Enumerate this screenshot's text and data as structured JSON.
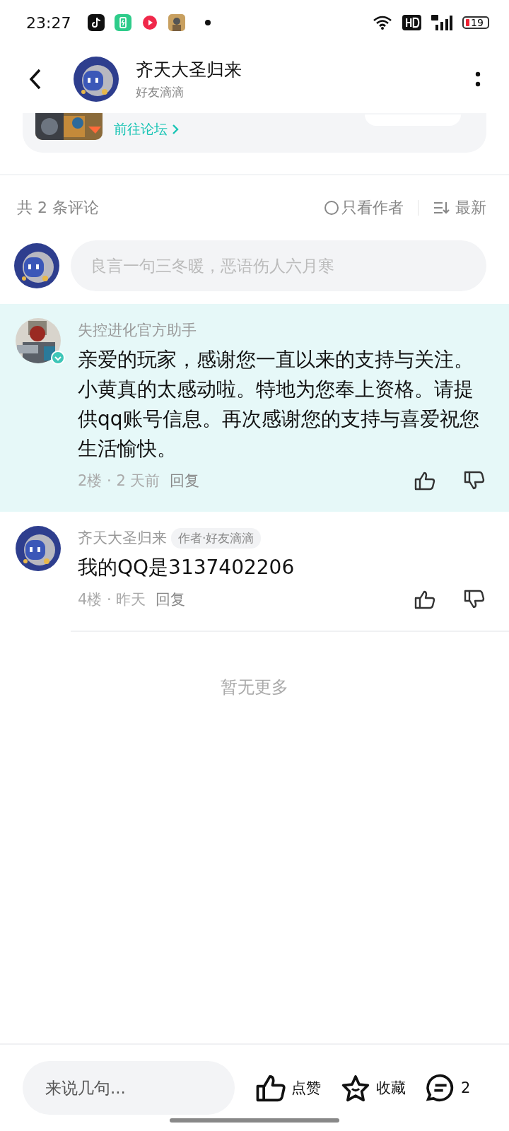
{
  "status_bar": {
    "time": "23:27",
    "battery": "19"
  },
  "header": {
    "title": "齐天大圣归来",
    "subtitle": "好友滴滴"
  },
  "card": {
    "link": "前往论坛"
  },
  "comments_bar": {
    "count": "共 2 条评论",
    "author_only": {
      "label": "只看作者",
      "checked": false
    },
    "sort": "最新"
  },
  "compose": {
    "placeholder": "良言一句三冬暖，恶语伤人六月寒"
  },
  "comments": [
    {
      "kind": "picture",
      "author": "失控进化官方助手",
      "verified": true,
      "highlighted": true,
      "text": "亲爱的玩家，感谢您一直以来的支持与关注。小黄真的太感动啦。特地为您奉上资格。请提供qq账号信息。再次感谢您的支持与喜爱祝您生活愉快。",
      "meta": "2楼 · 2 天前",
      "reply": "回复"
    },
    {
      "kind": "robot",
      "author": "齐天大圣归来",
      "badge": "作者·好友滴滴",
      "verified": false,
      "highlighted": false,
      "text": "我的QQ是3137402206",
      "meta": "4楼 · 昨天",
      "reply": "回复"
    }
  ],
  "end_note": "暂无更多",
  "bottom_bar": {
    "placeholder": "来说几句...",
    "like": "点赞",
    "favorite": "收藏",
    "comment_count": "2"
  }
}
